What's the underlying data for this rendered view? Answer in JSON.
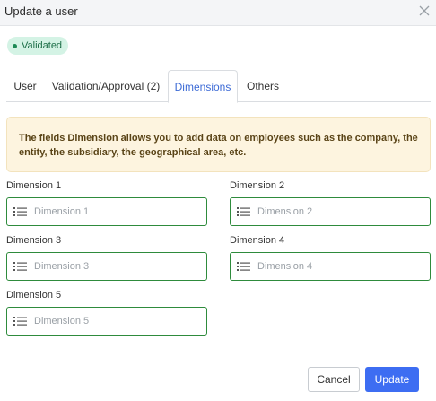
{
  "dialog": {
    "title": "Update a user",
    "close_icon": "close-icon"
  },
  "status": {
    "label": "Validated",
    "bg_color": "#d4f3e5",
    "dot_color": "#1c8a55"
  },
  "tabs": [
    {
      "label": "User",
      "active": false
    },
    {
      "label": "Validation/Approval (2)",
      "active": false
    },
    {
      "label": "Dimensions",
      "active": true
    },
    {
      "label": "Others",
      "active": false
    }
  ],
  "info_text": "The fields Dimension allows you to add data on employees such as the company, the entity, the subsidiary, the geographical area, etc.",
  "fields": [
    {
      "label": "Dimension 1",
      "placeholder": "Dimension 1",
      "value": "",
      "icon": "list-icon"
    },
    {
      "label": "Dimension 2",
      "placeholder": "Dimension 2",
      "value": "",
      "icon": "list-icon"
    },
    {
      "label": "Dimension 3",
      "placeholder": "Dimension 3",
      "value": "",
      "icon": "list-icon"
    },
    {
      "label": "Dimension 4",
      "placeholder": "Dimension 4",
      "value": "",
      "icon": "list-icon"
    },
    {
      "label": "Dimension 5",
      "placeholder": "Dimension 5",
      "value": "",
      "icon": "list-icon"
    }
  ],
  "footer": {
    "cancel_label": "Cancel",
    "update_label": "Update"
  },
  "colors": {
    "accent": "#3d6df2",
    "field_border": "#2e8b3c",
    "info_bg": "#fdf4df"
  }
}
